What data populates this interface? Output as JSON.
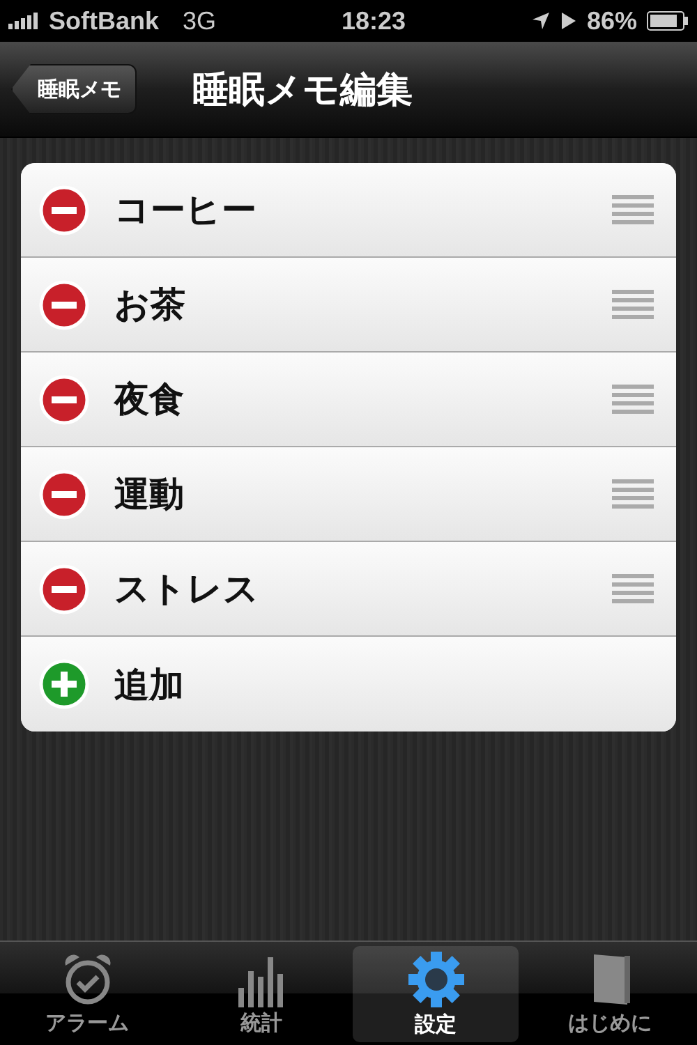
{
  "status_bar": {
    "carrier": "SoftBank",
    "network": "3G",
    "time": "18:23",
    "battery": "86%"
  },
  "nav_bar": {
    "back": "睡眠メモ",
    "title": "睡眠メモ編集"
  },
  "items": [
    {
      "label": "コーヒー",
      "kind": "delete"
    },
    {
      "label": "お茶",
      "kind": "delete"
    },
    {
      "label": "夜食",
      "kind": "delete"
    },
    {
      "label": "運動",
      "kind": "delete"
    },
    {
      "label": "ストレス",
      "kind": "delete"
    },
    {
      "label": "追加",
      "kind": "add"
    }
  ],
  "tabs": [
    {
      "label": "アラーム",
      "selected": false
    },
    {
      "label": "統計",
      "selected": false
    },
    {
      "label": "設定",
      "selected": true
    },
    {
      "label": "はじめに",
      "selected": false
    }
  ]
}
